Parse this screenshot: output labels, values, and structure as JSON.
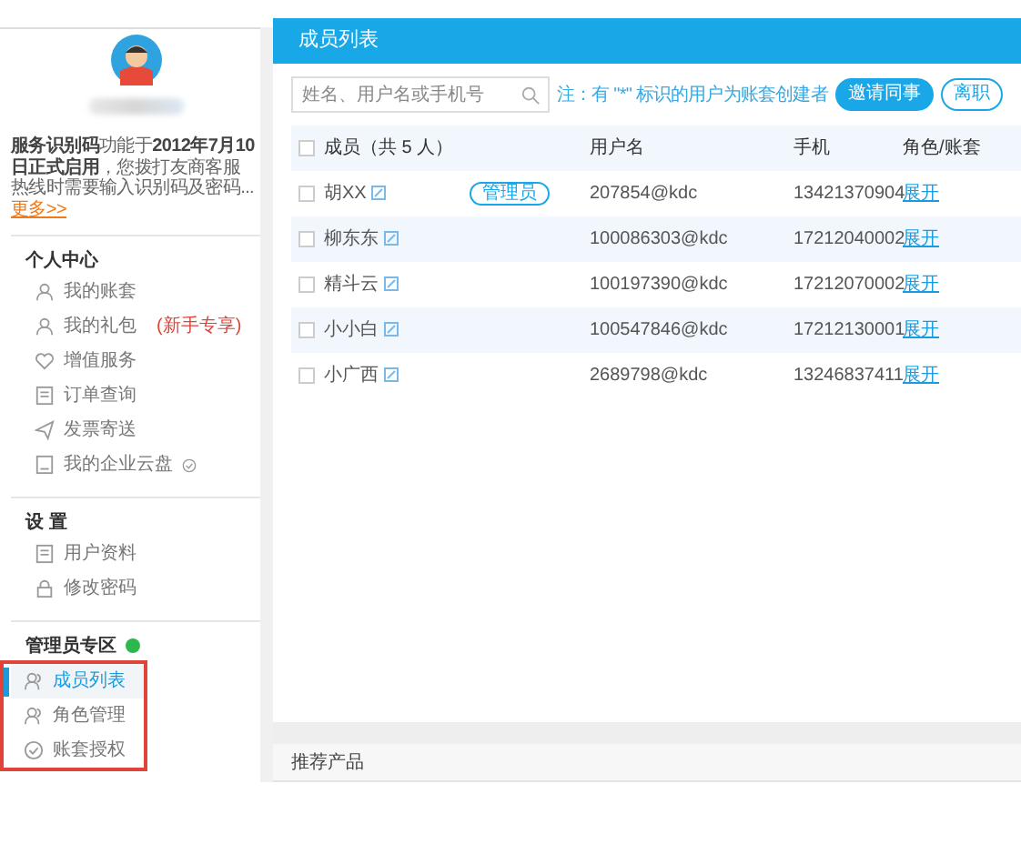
{
  "sidebar": {
    "notice": "**服务识别码**功能于**2012年7月10日正式启用**，您拨打友商客服热线时需要输入识别码及密码...",
    "notice_link": "更多>>",
    "sections": [
      {
        "title": "个人中心",
        "badge": false,
        "highlighted": false,
        "items": [
          {
            "label": "我的账套",
            "kind": "user",
            "selected": false
          },
          {
            "label": "我的礼包",
            "kind": "user",
            "tag": "(新手专享)",
            "selected": false
          },
          {
            "label": "增值服务",
            "kind": "heart",
            "selected": false
          },
          {
            "label": "订单查询",
            "kind": "doc",
            "selected": false
          },
          {
            "label": "发票寄送",
            "kind": "send",
            "selected": false
          },
          {
            "label": "我的企业云盘",
            "kind": "disk",
            "selected": false
          }
        ]
      },
      {
        "title": "设 置",
        "badge": false,
        "highlighted": false,
        "items": [
          {
            "label": "用户资料",
            "kind": "doc",
            "selected": false
          },
          {
            "label": "修改密码",
            "kind": "lock",
            "selected": false
          }
        ]
      },
      {
        "title": "管理员专区",
        "badge": true,
        "highlighted": true,
        "items": [
          {
            "label": "成员列表",
            "kind": "users",
            "selected": true
          },
          {
            "label": "角色管理",
            "kind": "users",
            "selected": false
          },
          {
            "label": "账套授权",
            "kind": "check",
            "selected": false
          }
        ]
      }
    ]
  },
  "main": {
    "title": "成员列表",
    "search": {
      "placeholder": "姓名、用户名或手机号"
    },
    "note": "注：有 \"*\" 标识的用户为账套创建者",
    "buttons": [
      {
        "label": "邀请同事",
        "kind": "primary"
      },
      {
        "label": "离职",
        "kind": "outline"
      }
    ],
    "table": {
      "header_checked": false,
      "columns": [
        "成员（共 5 人）",
        "用户名",
        "手机",
        "角色/账套"
      ],
      "rows": [
        {
          "name": "胡XX",
          "role": "管理员",
          "username": "207854@kdc",
          "phone": "13421370904",
          "action": "展开",
          "checked": false
        },
        {
          "name": "柳东东",
          "username": "100086303@kdc",
          "phone": "17212040002",
          "action": "展开",
          "checked": false
        },
        {
          "name": "精斗云",
          "username": "100197390@kdc",
          "phone": "17212070002",
          "action": "展开",
          "checked": false
        },
        {
          "name": "小小白",
          "username": "100547846@kdc",
          "phone": "17212130001",
          "action": "展开",
          "checked": false
        },
        {
          "name": "小广西",
          "username": "2689798@kdc",
          "phone": "13246837411",
          "action": "展开",
          "checked": false
        }
      ]
    }
  },
  "footer_panel": {
    "title": "推荐产品"
  }
}
